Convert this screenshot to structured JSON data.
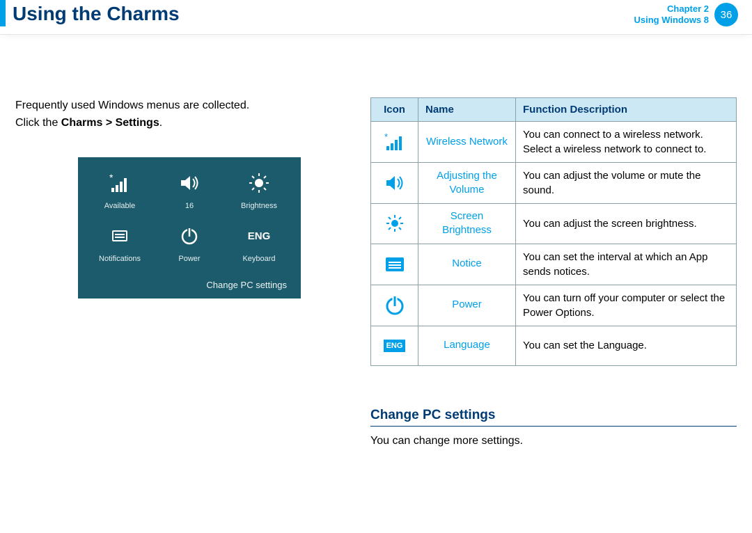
{
  "header": {
    "title": "Using the Charms",
    "chapter_line": "Chapter 2",
    "section_line": "Using Windows 8",
    "page_number": "36"
  },
  "left": {
    "intro": "Frequently used Windows menus are collected.",
    "click_prefix": "Click the ",
    "click_bold": "Charms > Settings",
    "click_suffix": ".",
    "panel": {
      "tiles": {
        "available": "Available",
        "volume_value": "16",
        "brightness": "Brightness",
        "notifications": "Notifications",
        "power": "Power",
        "keyboard_code": "ENG",
        "keyboard": "Keyboard"
      },
      "change_link": "Change PC settings"
    }
  },
  "table": {
    "headers": {
      "icon": "Icon",
      "name": "Name",
      "desc": "Function Description"
    },
    "rows": {
      "wireless": {
        "name": "Wireless Network",
        "desc": "You can connect to a wireless network. Select a wireless network to connect to."
      },
      "volume": {
        "name": "Adjusting the Volume",
        "desc": "You can adjust the volume or mute the sound."
      },
      "brightness": {
        "name": "Screen Brightness",
        "desc": "You can adjust the screen brightness."
      },
      "notice": {
        "name": "Notice",
        "desc": "You can set the interval at which an App sends notices."
      },
      "power": {
        "name": "Power",
        "desc": "You can turn off your computer or select the Power Options."
      },
      "language": {
        "name": "Language",
        "badge": "ENG",
        "desc": "You can set the Language."
      }
    }
  },
  "subsection": {
    "heading": "Change PC settings",
    "text": "You can change more settings."
  }
}
